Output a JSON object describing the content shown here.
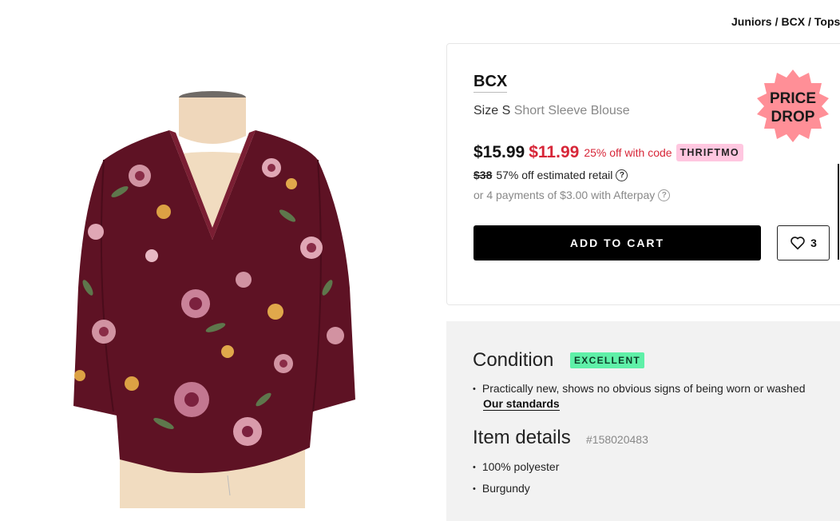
{
  "breadcrumb": {
    "items": [
      "Juniors",
      "BCX",
      "Tops"
    ],
    "separator": "/"
  },
  "product": {
    "brand": "BCX",
    "size": "Size S",
    "type": "Short Sleeve Blouse",
    "original_price": "$15.99",
    "sale_price": "$11.99",
    "promo_text": "25% off with code",
    "promo_code": "THRIFTMO",
    "retail_price": "$38",
    "retail_text": "57% off estimated retail",
    "afterpay_text": "or 4 payments of $3.00 with Afterpay",
    "add_to_cart_label": "ADD TO CART",
    "favorite_count": "3",
    "price_drop_badge": [
      "PRICE",
      "DROP"
    ]
  },
  "condition": {
    "title": "Condition",
    "badge": "EXCELLENT",
    "description": "Practically new, shows no obvious signs of being worn or washed",
    "standards_link": "Our standards"
  },
  "item_details": {
    "title": "Item details",
    "id": "#158020483",
    "bullets": [
      "100% polyester",
      "Burgundy"
    ]
  },
  "colors": {
    "sale_red": "#d72638",
    "promo_pink": "#ffc7e0",
    "badge_green": "#5ff0a8",
    "price_drop_pink": "#ff8f97",
    "garment_burgundy": "#5e1224",
    "details_bg": "#f2f2f2"
  },
  "icons": {
    "heart": "heart-icon",
    "info": "info-icon"
  }
}
